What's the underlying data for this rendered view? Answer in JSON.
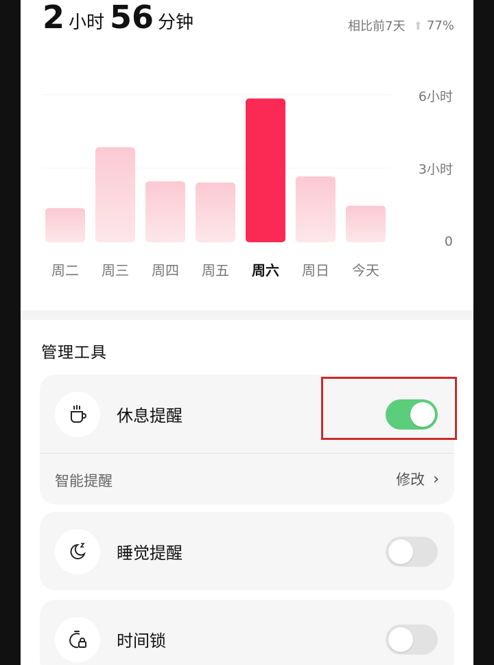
{
  "summary": {
    "hours_value": "2",
    "hours_unit": "小时",
    "minutes_value": "56",
    "minutes_unit": "分钟",
    "compare_label": "相比前7天",
    "compare_value": "77%",
    "compare_icon": "arrow-up-icon"
  },
  "chart_data": {
    "type": "bar",
    "categories": [
      "周二",
      "周三",
      "周四",
      "周五",
      "周六",
      "周日",
      "今天"
    ],
    "values": [
      1.4,
      3.9,
      2.5,
      2.45,
      5.9,
      2.7,
      1.5
    ],
    "highlighted": "周六",
    "y_tick_labels": [
      "6小时",
      "3小时",
      "0"
    ],
    "ylim": [
      0,
      6
    ],
    "colors": {
      "bar": "#fde2e7",
      "bar_top": "#fbc9d2",
      "highlight": "#fa2a55"
    }
  },
  "section_title": "管理工具",
  "tools": {
    "rest_reminder": {
      "label": "休息提醒",
      "icon": "cup-icon",
      "enabled": true
    },
    "smart_reminder": {
      "label": "智能提醒",
      "action": "修改"
    },
    "sleep_reminder": {
      "label": "睡觉提醒",
      "icon": "moon-icon",
      "enabled": false
    },
    "time_lock": {
      "label": "时间锁",
      "icon": "timer-lock-icon",
      "enabled": false
    }
  },
  "colors": {
    "toggle_on": "#5ccd7b",
    "toggle_off": "#e2e2e2",
    "highlight_box": "#cc2a2a"
  }
}
